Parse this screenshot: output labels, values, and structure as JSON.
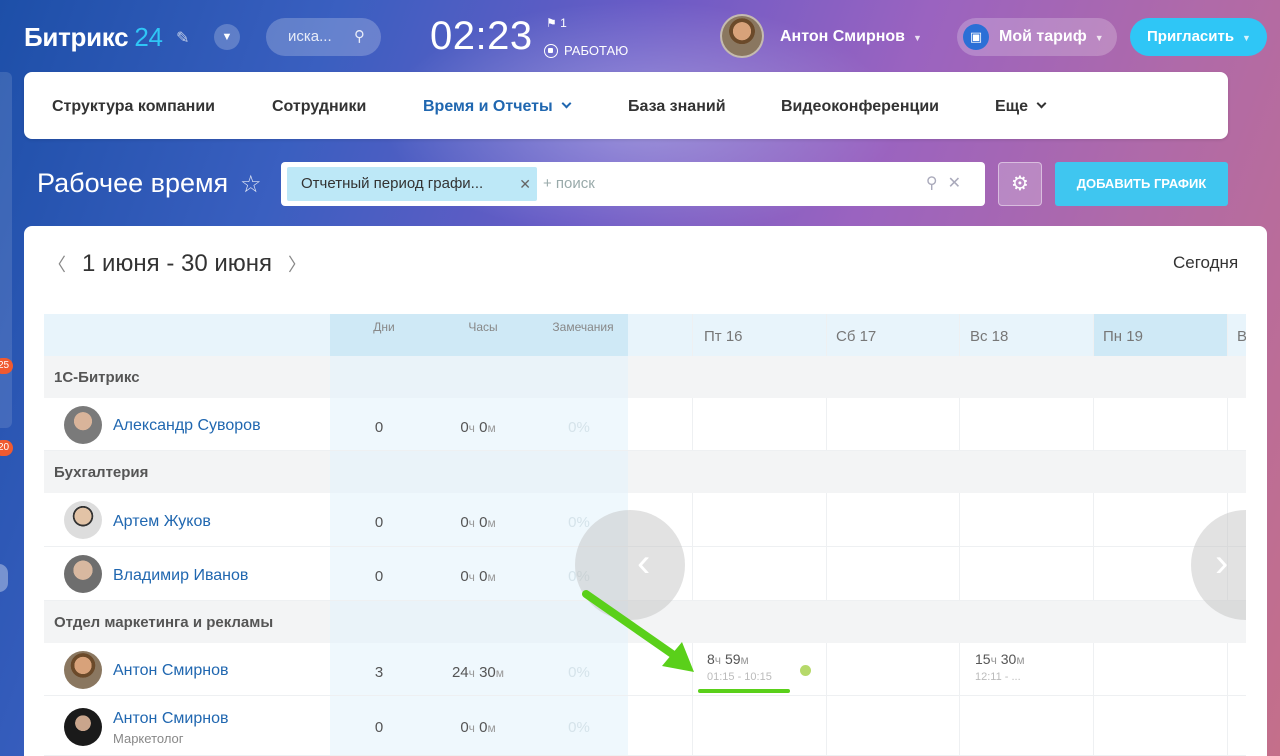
{
  "header": {
    "logo_main": "Битрикс",
    "logo_num": "24",
    "search_placeholder": "иска...",
    "clock": "02:23",
    "flag_count": "1",
    "work_status": "РАБОТАЮ",
    "user_name": "Антон Смирнов",
    "tariff_label": "Мой тариф",
    "invite_label": "Пригласить"
  },
  "left_badges": [
    "25",
    "20"
  ],
  "nav": {
    "items": [
      {
        "label": "Структура компании"
      },
      {
        "label": "Сотрудники"
      },
      {
        "label": "Время и Отчеты"
      },
      {
        "label": "База знаний"
      },
      {
        "label": "Видеоконференции"
      },
      {
        "label": "Еще"
      }
    ]
  },
  "page": {
    "title": "Рабочее время",
    "filter_chip": "Отчетный период графи...",
    "filter_search": "+ поиск",
    "add_button": "ДОБАВИТЬ ГРАФИК",
    "period": "1 июня - 30 июня",
    "today": "Сегодня"
  },
  "table": {
    "headers": {
      "days": "Дни",
      "hours": "Часы",
      "notes": "Замечания"
    },
    "day_headers": [
      "Пт 16",
      "Сб 17",
      "Вс 18",
      "Пн 19",
      "В"
    ],
    "groups": [
      "1С-Битрикс",
      "Бухгалтерия",
      "Отдел маркетинга и рекламы"
    ],
    "rows": [
      {
        "name": "Александр Суворов",
        "days": "0",
        "h": "0",
        "m": "0",
        "pct": "0%"
      },
      {
        "name": "Артем Жуков",
        "days": "0",
        "h": "0",
        "m": "0",
        "pct": "0%"
      },
      {
        "name": "Владимир Иванов",
        "days": "0",
        "h": "0",
        "m": "0",
        "pct": "0%"
      },
      {
        "name": "Антон Смирнов",
        "days": "3",
        "h": "24",
        "m": "30",
        "pct": "0%"
      },
      {
        "name": "Антон Смирнов",
        "sub": "Маркетолог",
        "days": "0",
        "h": "0",
        "m": "0",
        "pct": "0%"
      }
    ],
    "unit_h": "ч",
    "unit_m": "м",
    "work_cells": [
      {
        "h": "8",
        "m": "59",
        "time": "01:15 - 10:15"
      },
      {
        "h": "15",
        "m": "30",
        "time": "12:11 - ..."
      }
    ]
  },
  "colors": {
    "accent": "#2fc6f6",
    "link": "#2067b0",
    "arrow": "#5ad01a"
  }
}
